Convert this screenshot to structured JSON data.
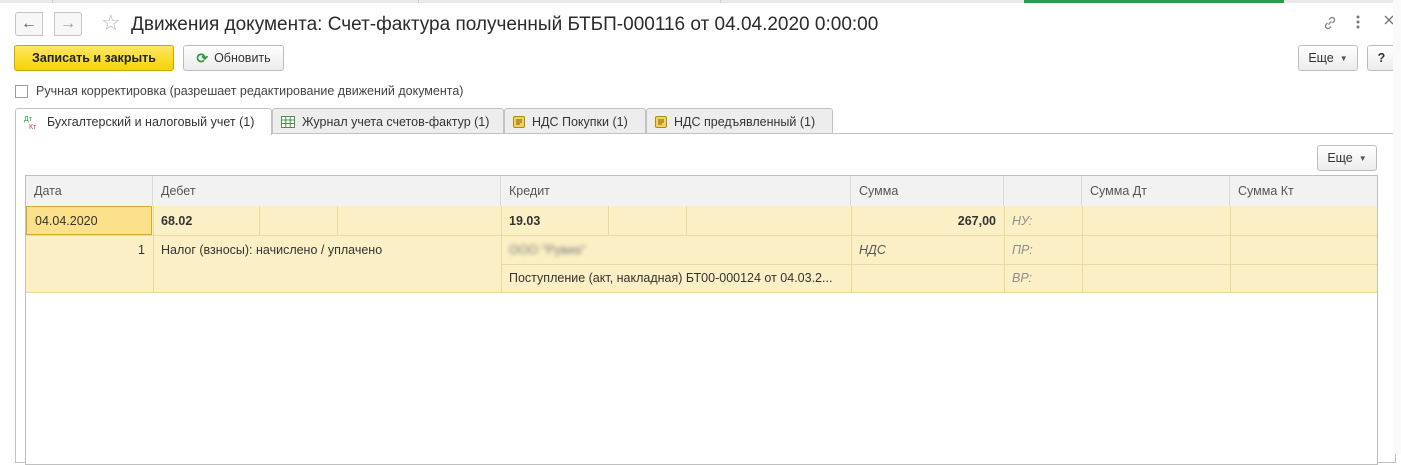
{
  "window": {
    "title": "Движения документа: Счет-фактура полученный БТБП-000116 от 04.04.2020 0:00:00",
    "nav_back_icon": "arrow-left-icon",
    "nav_forward_icon": "arrow-right-icon",
    "favorite_icon": "star-icon",
    "link_icon": "link-icon",
    "more_icon": "vertical-dots-icon",
    "close_icon": "close-icon"
  },
  "toolbar": {
    "save_close_label": "Записать и закрыть",
    "refresh_label": "Обновить",
    "more_label": "Еще",
    "help_label": "?"
  },
  "manual_edit": {
    "label": "Ручная корректировка (разрешает редактирование движений документа)",
    "checked": false
  },
  "tabs": [
    {
      "label": "Бухгалтерский и налоговый учет (1)",
      "icon": "dt-kt-icon",
      "active": true
    },
    {
      "label": "Журнал учета счетов-фактур (1)",
      "icon": "table-icon",
      "active": false
    },
    {
      "label": "НДС Покупки (1)",
      "icon": "register-icon",
      "active": false
    },
    {
      "label": "НДС предъявленный (1)",
      "icon": "register-icon",
      "active": false
    }
  ],
  "panel": {
    "more_label": "Еще"
  },
  "table": {
    "columns": [
      "Дата",
      "Дебет",
      "Кредит",
      "Сумма",
      "",
      "Сумма Дт",
      "Сумма Кт"
    ],
    "row": {
      "date": "04.04.2020",
      "line_number": "1",
      "debit_account": "68.02",
      "debit_subconto": "Налог (взносы): начислено / уплачено",
      "credit_account": "19.03",
      "credit_subconto_1": "ООО \"Рувиа\"",
      "credit_subconto_2": "Поступление (акт, накладная) БТ00-000124 от 04.03.2...",
      "amount": "267,00",
      "amount_note": "НДС",
      "tax_labels": [
        "НУ:",
        "ПР:",
        "ВР:"
      ]
    }
  },
  "colors": {
    "primary_button": "#f5d400",
    "row_highlight": "#fbf0c5",
    "selected_cell": "#fde08a",
    "refresh_icon": "#2f9a3f"
  }
}
